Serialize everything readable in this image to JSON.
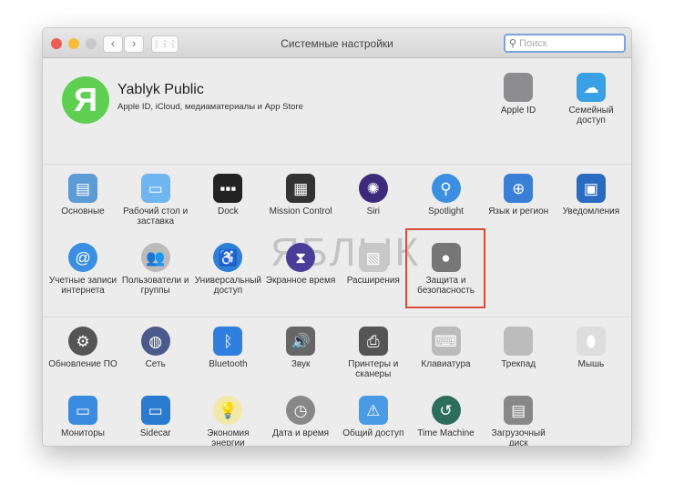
{
  "window": {
    "title": "Системные настройки",
    "search_placeholder": "Поиск",
    "back": "‹",
    "forward": "›",
    "grid": "⋮⋮⋮"
  },
  "colors": {
    "close": "#ee5c54",
    "minimize": "#f6bd3b",
    "zoom": "#c9c9c9",
    "highlight": "#d94b3b"
  },
  "user": {
    "initial": "Я",
    "name": "Yablyk Public",
    "subtitle": "Apple ID, iCloud, медиаматериалы и App Store",
    "items": [
      {
        "label": "Apple ID",
        "icon": "apple-icon",
        "glyph": "",
        "color": "#8d8d8f"
      },
      {
        "label": "Семейный доступ",
        "icon": "family-icon",
        "glyph": "☁",
        "color": "#3aa0e6"
      }
    ]
  },
  "watermark": "ЯБЛЫК",
  "section1": [
    {
      "label": "Основные",
      "icon": "general-icon",
      "glyph": "▤",
      "color": "#5d9bd4"
    },
    {
      "label": "Рабочий стол и заставка",
      "icon": "desktop-icon",
      "glyph": "▭",
      "color": "#6fb6f0"
    },
    {
      "label": "Dock",
      "icon": "dock-icon",
      "glyph": "▪▪▪",
      "color": "#222"
    },
    {
      "label": "Mission Control",
      "icon": "mission-control-icon",
      "glyph": "▦",
      "color": "#333"
    },
    {
      "label": "Siri",
      "icon": "siri-icon",
      "glyph": "✺",
      "color": "#3b2b7a",
      "round": true
    },
    {
      "label": "Spotlight",
      "icon": "spotlight-icon",
      "glyph": "⚲",
      "color": "#3c8fe0",
      "round": true
    },
    {
      "label": "Язык и регион",
      "icon": "language-icon",
      "glyph": "⊕",
      "color": "#3a7fd6"
    },
    {
      "label": "Уведомления",
      "icon": "notifications-icon",
      "glyph": "▣",
      "color": "#2a6bc2"
    },
    {
      "label": "Учетные записи интернета",
      "icon": "internet-accounts-icon",
      "glyph": "@",
      "color": "#3a8fe3",
      "round": true
    },
    {
      "label": "Пользователи и группы",
      "icon": "users-icon",
      "glyph": "👥",
      "color": "#bbb",
      "round": true
    },
    {
      "label": "Универсальный доступ",
      "icon": "accessibility-icon",
      "glyph": "♿",
      "color": "#2d7fd8",
      "round": true
    },
    {
      "label": "Экранное время",
      "icon": "screen-time-icon",
      "glyph": "⧗",
      "color": "#4a3d9a",
      "round": true
    },
    {
      "label": "Расширения",
      "icon": "extensions-icon",
      "glyph": "▧",
      "color": "#c8c8c8"
    },
    {
      "label": "Защита и безопасность",
      "icon": "security-icon",
      "glyph": "●",
      "color": "#777"
    }
  ],
  "section2": [
    {
      "label": "Обновление ПО",
      "icon": "software-update-icon",
      "glyph": "⚙",
      "color": "#555",
      "round": true
    },
    {
      "label": "Сеть",
      "icon": "network-icon",
      "glyph": "◍",
      "color": "#4a5a8a",
      "round": true
    },
    {
      "label": "Bluetooth",
      "icon": "bluetooth-icon",
      "glyph": "ᛒ",
      "color": "#2f7fe0"
    },
    {
      "label": "Звук",
      "icon": "sound-icon",
      "glyph": "🔊",
      "color": "#666"
    },
    {
      "label": "Принтеры и сканеры",
      "icon": "printers-icon",
      "glyph": "⎙",
      "color": "#555"
    },
    {
      "label": "Клавиатура",
      "icon": "keyboard-icon",
      "glyph": "⌨",
      "color": "#bbb"
    },
    {
      "label": "Трекпад",
      "icon": "trackpad-icon",
      "glyph": "",
      "color": "#bcbcbc"
    },
    {
      "label": "Мышь",
      "icon": "mouse-icon",
      "glyph": "⬮",
      "color": "#ddd"
    },
    {
      "label": "Мониторы",
      "icon": "displays-icon",
      "glyph": "▭",
      "color": "#3a8be0"
    },
    {
      "label": "Sidecar",
      "icon": "sidecar-icon",
      "glyph": "▭",
      "color": "#2a7ad0"
    },
    {
      "label": "Экономия энергии",
      "icon": "energy-saver-icon",
      "glyph": "💡",
      "color": "#f2e9a8",
      "round": true
    },
    {
      "label": "Дата и время",
      "icon": "date-time-icon",
      "glyph": "◷",
      "color": "#888",
      "round": true
    },
    {
      "label": "Общий доступ",
      "icon": "sharing-icon",
      "glyph": "⚠",
      "color": "#4a9be6"
    },
    {
      "label": "Time Machine",
      "icon": "time-machine-icon",
      "glyph": "↺",
      "color": "#2c6e5a",
      "round": true
    },
    {
      "label": "Загрузочный диск",
      "icon": "startup-disk-icon",
      "glyph": "▤",
      "color": "#888"
    }
  ]
}
